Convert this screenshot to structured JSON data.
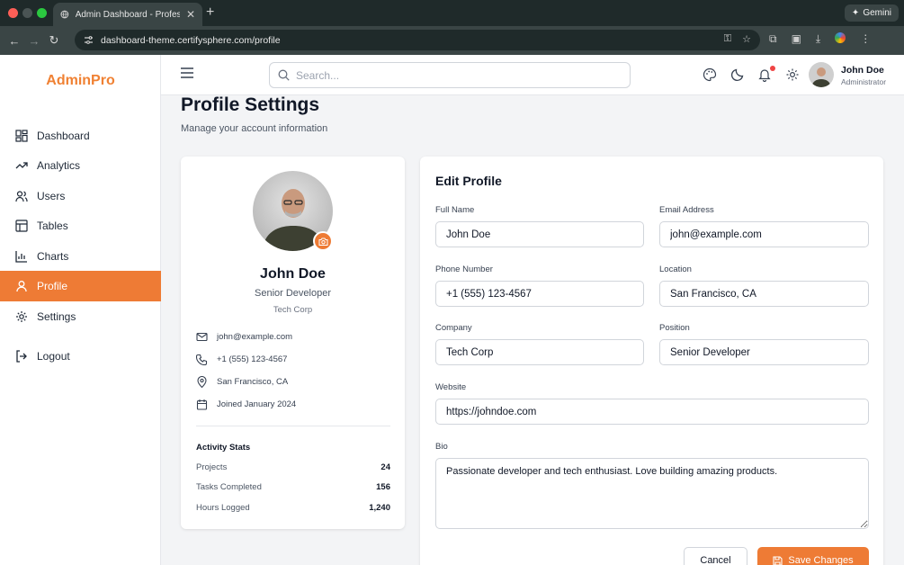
{
  "browser": {
    "tab_title": "Admin Dashboard - Professio",
    "url": "dashboard-theme.certifysphere.com/profile",
    "gemini_label": "Gemini"
  },
  "sidebar": {
    "brand": "AdminPro",
    "items": [
      {
        "label": "Dashboard",
        "icon": "dashboard-icon"
      },
      {
        "label": "Analytics",
        "icon": "trending-up-icon"
      },
      {
        "label": "Users",
        "icon": "users-icon"
      },
      {
        "label": "Tables",
        "icon": "table-icon"
      },
      {
        "label": "Charts",
        "icon": "bar-chart-icon"
      },
      {
        "label": "Profile",
        "icon": "user-icon",
        "active": true
      },
      {
        "label": "Settings",
        "icon": "gear-icon"
      },
      {
        "label": "Logout",
        "icon": "logout-icon"
      }
    ]
  },
  "header": {
    "search_placeholder": "Search...",
    "user_name": "John Doe",
    "user_role": "Administrator"
  },
  "page": {
    "title": "Profile Settings",
    "subtitle": "Manage your account information"
  },
  "profile_card": {
    "name": "John Doe",
    "role": "Senior Developer",
    "company": "Tech Corp",
    "email": "john@example.com",
    "phone": "+1 (555) 123-4567",
    "location": "San Francisco, CA",
    "joined": "Joined January 2024",
    "stats_title": "Activity Stats",
    "stats": [
      {
        "label": "Projects",
        "value": "24"
      },
      {
        "label": "Tasks Completed",
        "value": "156"
      },
      {
        "label": "Hours Logged",
        "value": "1,240"
      }
    ]
  },
  "edit_profile": {
    "title": "Edit Profile",
    "full_name_label": "Full Name",
    "full_name": "John Doe",
    "email_label": "Email Address",
    "email": "john@example.com",
    "phone_label": "Phone Number",
    "phone": "+1 (555) 123-4567",
    "location_label": "Location",
    "location": "San Francisco, CA",
    "company_label": "Company",
    "company": "Tech Corp",
    "position_label": "Position",
    "position": "Senior Developer",
    "website_label": "Website",
    "website": "https://johndoe.com",
    "bio_label": "Bio",
    "bio": "Passionate developer and tech enthusiast. Love building amazing products.",
    "cancel_label": "Cancel",
    "save_label": "Save Changes"
  },
  "colors": {
    "accent": "#ee7b35",
    "brand": "#f08133",
    "notification": "#ef4444"
  }
}
